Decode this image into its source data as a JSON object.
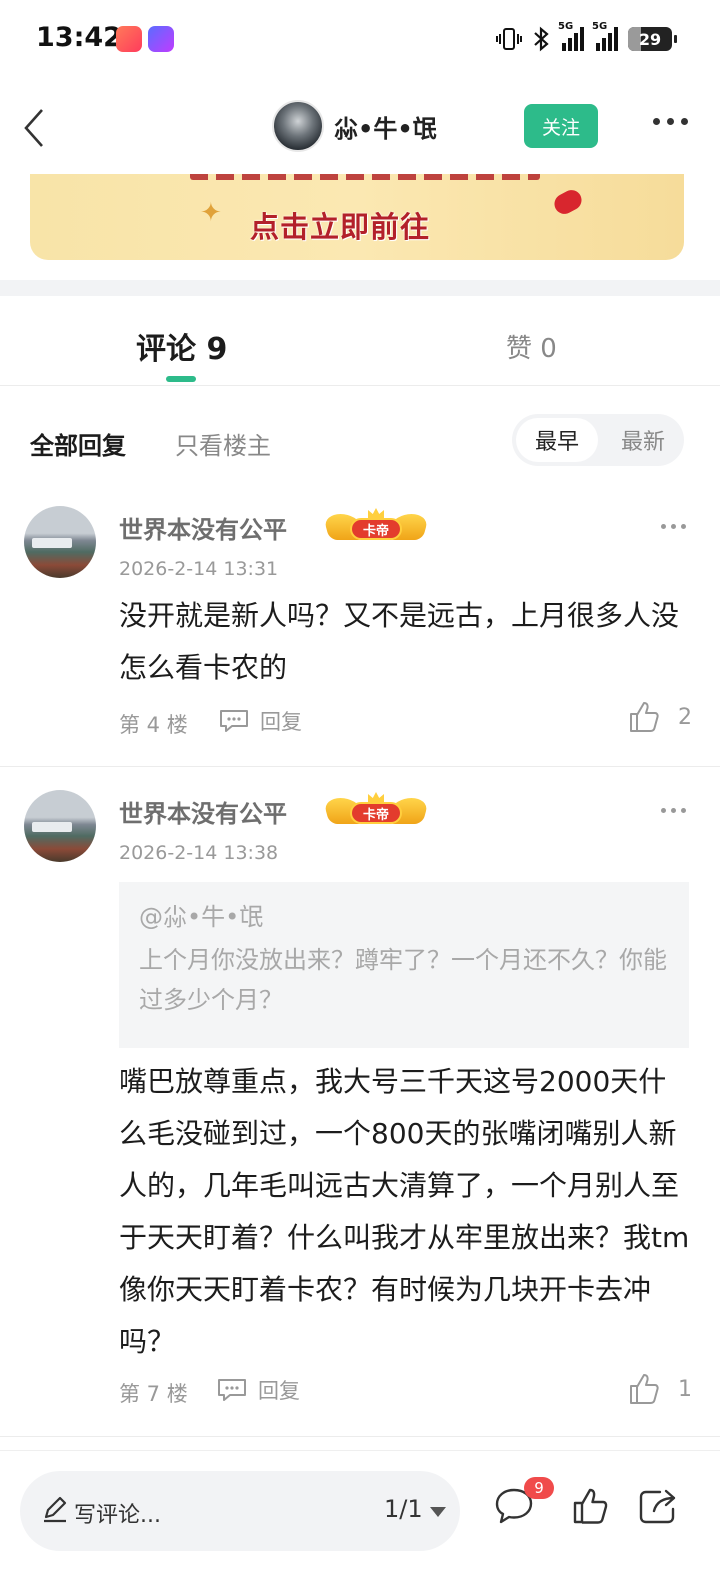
{
  "status_bar": {
    "time": "13:42",
    "network_1": "5G",
    "network_2": "5G",
    "battery": "29",
    "battery_level": 0.29
  },
  "header": {
    "author_name": "尛•牛•氓",
    "follow_label": "关注"
  },
  "banner": {
    "cta": "点击立即前往"
  },
  "tabs": {
    "comments_label": "评论 9",
    "likes_label": "赞 0"
  },
  "filters": {
    "all_label": "全部回复",
    "op_only_label": "只看楼主",
    "sort_earliest": "最早",
    "sort_newest": "最新"
  },
  "comments": [
    {
      "user": "世界本没有公平",
      "badge": "卡帝",
      "time": "2026-2-14 13:31",
      "body": "没开就是新人吗？又不是远古，上月很多人没怎么看卡农的",
      "floor": "第 4 楼",
      "reply_label": "回复",
      "likes": "2"
    },
    {
      "user": "世界本没有公平",
      "badge": "卡帝",
      "time": "2026-2-14 13:38",
      "quote_user": "@尛•牛•氓",
      "quote_text": "上个月你没放出来？蹲牢了？一个月还不久？你能过多少个月？",
      "body": "嘴巴放尊重点，我大号三千天这号2000天什么毛没碰到过，一个800天的张嘴闭嘴别人新人的，几年毛叫远古大清算了，一个月别人至于天天盯着？什么叫我才从牢里放出来？我tm像你天天盯着卡农？有时候为几块开卡去冲吗？",
      "floor": "第 7 楼",
      "reply_label": "回复",
      "likes": "1"
    }
  ],
  "bottom_bar": {
    "write_placeholder": "写评论...",
    "page_indicator": "1/1",
    "comment_count_badge": "9"
  },
  "colors": {
    "accent_green": "#2dbb8a",
    "badge_red": "#f04b4b",
    "banner_text": "#b3202a"
  }
}
